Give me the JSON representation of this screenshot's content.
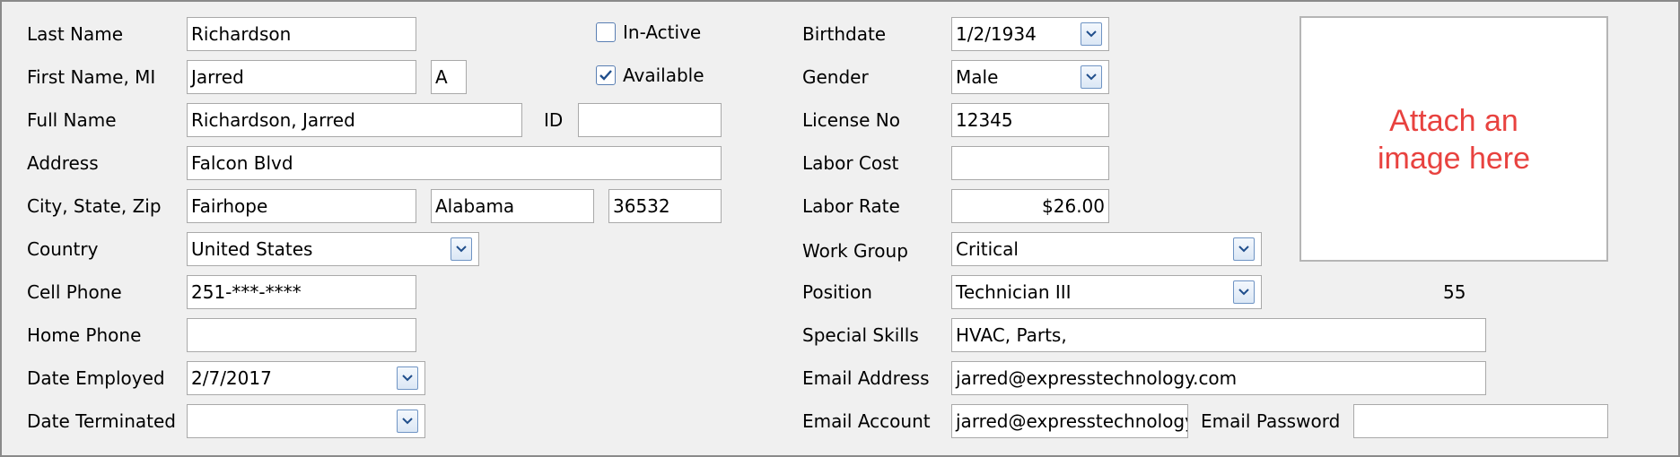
{
  "left": {
    "last_name": {
      "label": "Last Name",
      "value": "Richardson"
    },
    "first_name": {
      "label": "First Name, MI",
      "value": "Jarred",
      "mi": "A"
    },
    "full_name": {
      "label": "Full Name",
      "value": "Richardson, Jarred"
    },
    "id": {
      "label": "ID",
      "value": ""
    },
    "address": {
      "label": "Address",
      "value": "Falcon Blvd"
    },
    "city_state_zip": {
      "label": "City, State, Zip",
      "city": "Fairhope",
      "state": "Alabama",
      "zip": "36532"
    },
    "country": {
      "label": "Country",
      "value": "United States"
    },
    "cell_phone": {
      "label": "Cell Phone",
      "value": "251-***-****"
    },
    "home_phone": {
      "label": "Home Phone",
      "value": ""
    },
    "date_employed": {
      "label": "Date Employed",
      "value": "2/7/2017"
    },
    "date_terminated": {
      "label": "Date Terminated",
      "value": ""
    }
  },
  "status": {
    "inactive": {
      "label": "In-Active",
      "checked": false
    },
    "available": {
      "label": "Available",
      "checked": true
    }
  },
  "right": {
    "birthdate": {
      "label": "Birthdate",
      "value": "1/2/1934"
    },
    "gender": {
      "label": "Gender",
      "value": "Male"
    },
    "license_no": {
      "label": "License No",
      "value": "12345"
    },
    "labor_cost": {
      "label": "Labor Cost",
      "value": ""
    },
    "labor_rate": {
      "label": "Labor Rate",
      "value": "$26.00"
    },
    "work_group": {
      "label": "Work Group",
      "value": "Critical"
    },
    "position": {
      "label": "Position",
      "value": "Technician III",
      "extra": "55"
    },
    "special_skills": {
      "label": "Special Skills",
      "value": "HVAC, Parts,"
    },
    "email_address": {
      "label": "Email Address",
      "value": "jarred@expresstechnology.com"
    },
    "email_account": {
      "label": "Email Account",
      "value": "jarred@expresstechnology"
    },
    "email_password": {
      "label": "Email Password",
      "value": ""
    }
  },
  "image": {
    "placeholder_line1": "Attach an",
    "placeholder_line2": "image here"
  },
  "icons": {
    "dropdown": "chevron-down-icon",
    "checkmark": "checkmark-icon"
  },
  "colors": {
    "accent": "#4a78b5",
    "image_text": "#e8423f",
    "panel_bg": "#f0f0f0"
  }
}
